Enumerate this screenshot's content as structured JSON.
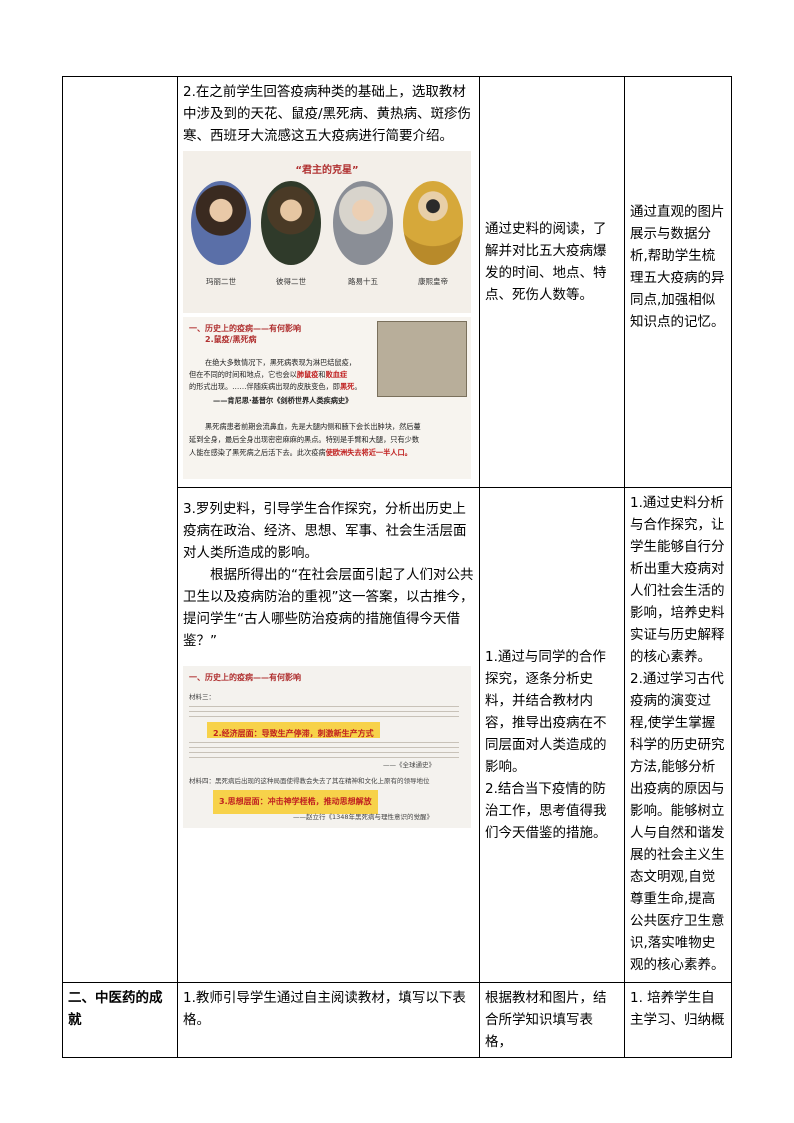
{
  "row1": {
    "col2_text": "2.在之前学生回答疫病种类的基础上，选取教材中涉及到的天花、鼠疫/黑死病、黄热病、斑疹伤寒、西班牙大流感这五大疫病进行简要介绍。",
    "kings_panel": {
      "title": "“君主的克星”",
      "captions": [
        "玛丽二世",
        "彼得二世",
        "路易十五",
        "康熙皇帝"
      ]
    },
    "plague_panel": {
      "heading1": "一、历史上的疫病——有何影响",
      "heading2": "2.鼠疫/黑死病",
      "line1": "在绝大多数情况下，黑死病表现为淋巴结鼠疫，",
      "line2a": "但在不同的时间和地点，它也会以",
      "line2b": "肺鼠疫",
      "line2c": "和",
      "line2d": "败血症",
      "line3a": "的形式出现。……伴随疾病出现的皮肤变色，即",
      "line3b": "黑死",
      "line3c": "。",
      "line4": "——肯尼思·基普尔《剑桥世界人类疾病史》",
      "line5": "黑死病患者前期会流鼻血，先是大腿内侧和腋下会长出肿块，然后蔓",
      "line6": "延到全身，最后全身出现密密麻麻的黑点。特别是手臂和大腿，只有少数",
      "line7a": "人能在感染了黑死病之后活下去。此次疫病",
      "line7b": "使欧洲失去将近一半人口。"
    },
    "col3_text": "通过史料的阅读，了解并对比五大疫病爆发的时间、地点、特点、死伤人数等。",
    "col4_text": "通过直观的图片展示与数据分析,帮助学生梳理五大疫病的异同点,加强相似知识点的记忆。"
  },
  "row2": {
    "p1": "3.罗列史料，引导学生合作探究，分析出历史上疫病在政治、经济、思想、军事、社会生活层面对人类所造成的影响。",
    "p2": "根据所得出的“在社会层面引起了人们对公共卫生以及疫病防治的重视”这一答案，以古推今，提问学生“古人哪些防治疫病的措施值得今天借鉴？”",
    "effect_panel": {
      "heading": "一、历史上的疫病——有何影响",
      "mat3": "材料三：",
      "hl1": "2.经济层面：导致生产停滞，刺激新生产方式",
      "source1": "——《全球通史》",
      "mat4": "材料四：黑死病后出现的这种局面使得教会失去了其在精神和文化上原有的领导地位",
      "hl2": "3.思想层面：冲击神学桎梏，推动思想解放",
      "source2": "——赵立行《1348年黑死病与理性意识的觉醒》"
    },
    "col3_p1": "1.通过与同学的合作探究，逐条分析史料，并结合教材内容，推导出疫病在不同层面对人类造成的影响。",
    "col3_p2": "2.结合当下疫情的防治工作，思考值得我们今天借鉴的措施。",
    "col4_p1": "1.通过史料分析与合作探究，让学生能够自行分析出重大疫病对人们社会生活的影响，培养史料实证与历史解释的核心素养。",
    "col4_p2": "2.通过学习古代疫病的演变过程,使学生掌握科学的历史研究方法,能够分析出疫病的原因与影响。能够树立人与自然和谐发展的社会主义生态文明观,自觉尊重生命,提高公共医疗卫生意识,落实唯物史观的核心素养。"
  },
  "row3": {
    "col1": "二、中医药的成就",
    "col2": "1.教师引导学生通过自主阅读教材，填写以下表格。",
    "col3": "根据教材和图片，结合所学知识填写表格，",
    "col4": "1. 培养学生自主学习、归纳概"
  }
}
